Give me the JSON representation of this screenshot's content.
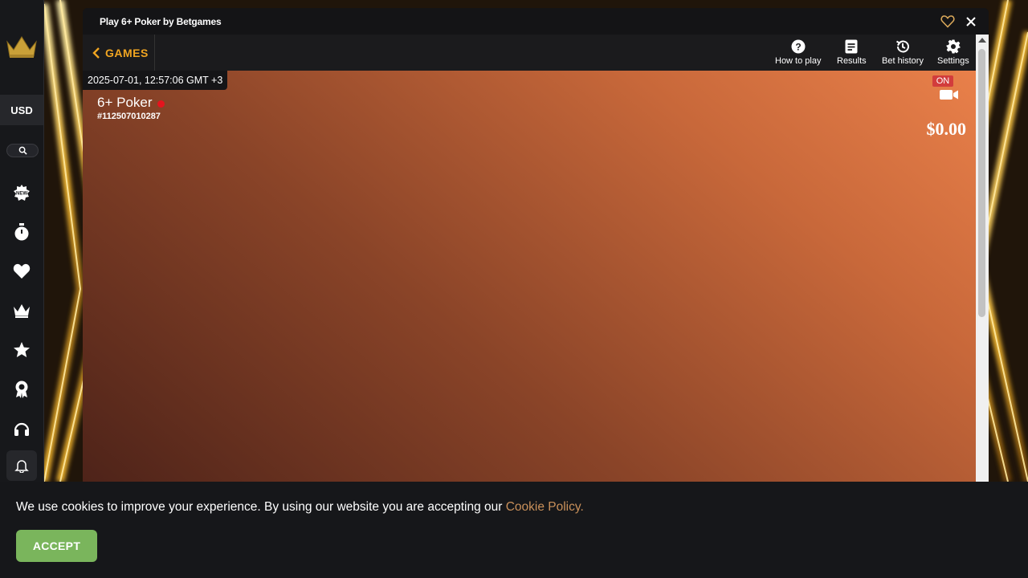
{
  "window": {
    "title": "Play 6+ Poker by Betgames"
  },
  "sidebar": {
    "currency": "USD",
    "items": [
      {
        "icon": "new-games-icon"
      },
      {
        "icon": "stopwatch-icon"
      },
      {
        "icon": "heart-icon"
      },
      {
        "icon": "crown-icon"
      },
      {
        "icon": "star-icon"
      },
      {
        "icon": "award-icon"
      },
      {
        "icon": "headset-icon"
      }
    ]
  },
  "game_header": {
    "back_label": "GAMES",
    "buttons": [
      {
        "label": "How to play",
        "icon": "question-icon"
      },
      {
        "label": "Results",
        "icon": "results-icon"
      },
      {
        "label": "Bet history",
        "icon": "history-icon"
      },
      {
        "label": "Settings",
        "icon": "gear-icon"
      }
    ]
  },
  "game": {
    "timestamp": "2025-07-01, 12:57:06 GMT +3",
    "name": "6+ Poker",
    "round_id": "#112507010287",
    "video_status": "ON",
    "balance": "$0.00"
  },
  "cookie": {
    "text": "We use cookies to improve your experience. By using our website you are accepting our ",
    "link": "Cookie Policy.",
    "accept": "ACCEPT"
  },
  "colors": {
    "accent": "#f0a521",
    "accept_button": "#7ab55c",
    "live_dot": "#e5141e",
    "link": "#c9905a"
  }
}
